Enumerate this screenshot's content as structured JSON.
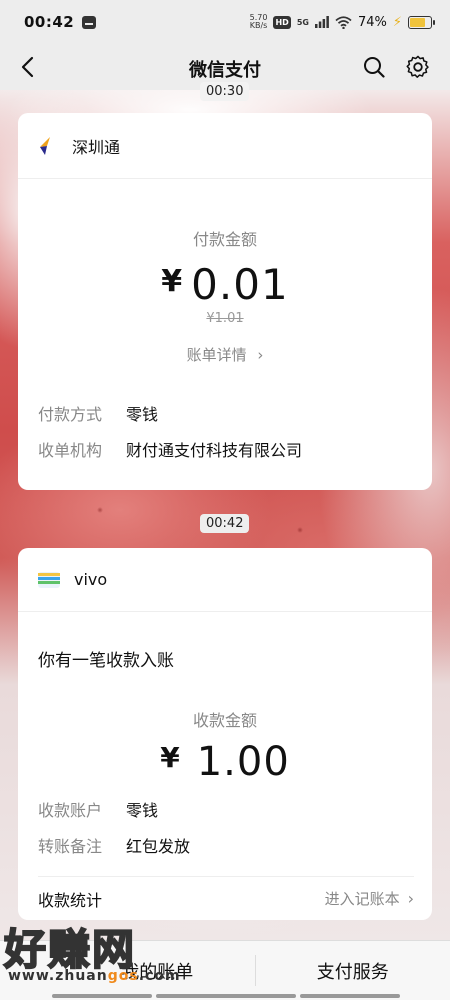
{
  "status_bar": {
    "time": "00:42",
    "net_speed_value": "5.70",
    "net_speed_unit": "KB/s",
    "hd": "HD",
    "signal": "5G",
    "battery": "74%"
  },
  "nav": {
    "title": "微信支付",
    "back_icon": "back-chevron-icon",
    "search_icon": "search-icon",
    "settings_icon": "gear-icon"
  },
  "messages": [
    {
      "time": "00:30",
      "merchant": "深圳通",
      "amount_label": "付款金额",
      "currency": "¥",
      "amount": "0.01",
      "original_amount": "¥1.01",
      "detail_link": "账单详情",
      "rows": [
        {
          "key": "付款方式",
          "value": "零钱"
        },
        {
          "key": "收单机构",
          "value": "财付通支付科技有限公司"
        }
      ]
    },
    {
      "time": "00:42",
      "merchant": "vivo",
      "headline": "你有一笔收款入账",
      "amount_label": "收款金额",
      "currency": "¥",
      "amount": "1.00",
      "rows": [
        {
          "key": "收款账户",
          "value": "零钱"
        },
        {
          "key": "转账备注",
          "value": "红包发放"
        }
      ],
      "footer_left": "收款统计",
      "footer_right": "进入记账本"
    }
  ],
  "bottom_bar": {
    "left_tab": "我的账单",
    "right_tab": "支付服务"
  },
  "watermark": {
    "logo_text": "好赚网",
    "url_a": "www.zhuan",
    "url_b": "gos",
    "url_c": ".com"
  },
  "colors": {
    "nav_bg": "#ededed",
    "card_bg": "#ffffff",
    "accent_yellow": "#f0c33b"
  }
}
